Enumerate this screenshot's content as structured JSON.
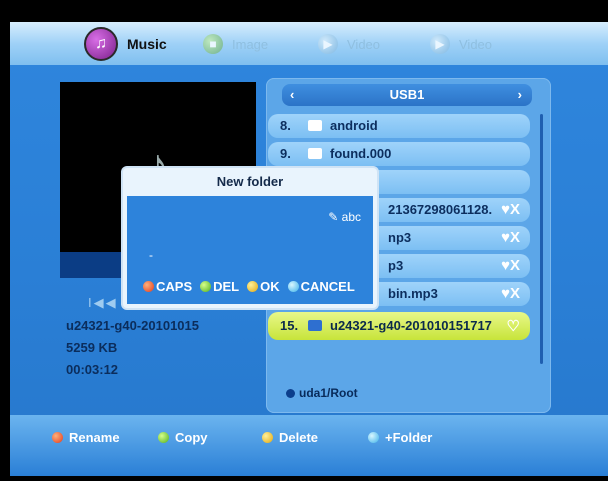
{
  "categories": [
    {
      "label": "Music",
      "icon": "music-note-icon",
      "active": true
    },
    {
      "label": "Image",
      "icon": "image-icon",
      "active": false
    },
    {
      "label": "Video",
      "icon": "video-icon",
      "active": false
    },
    {
      "label": "Video",
      "icon": "video-icon",
      "active": false
    }
  ],
  "preview": {
    "filename": "u24321-g40-20101015",
    "size": "5259 KB",
    "duration": "00:03:12",
    "controls": "I◀◀ ◀"
  },
  "filelist": {
    "directory": "USB1",
    "rows": [
      {
        "num": "8.",
        "name": "android",
        "type": "folder",
        "mark": ""
      },
      {
        "num": "9.",
        "name": "found.000",
        "type": "folder",
        "mark": ""
      },
      {
        "num": "",
        "name": "",
        "type": "folder",
        "mark": ""
      },
      {
        "num": "",
        "name": "21367298061128.",
        "type": "file",
        "mark": "♥X"
      },
      {
        "num": "",
        "name": "np3",
        "type": "file",
        "mark": "♥X"
      },
      {
        "num": "",
        "name": "p3",
        "type": "file",
        "mark": "♥X"
      },
      {
        "num": "",
        "name": "bin.mp3",
        "type": "file",
        "mark": "♥X"
      },
      {
        "num": "15.",
        "name": "u24321-g40-201010151717",
        "type": "file",
        "mark": "♡",
        "selected": true
      }
    ],
    "path": "uda1/Root"
  },
  "dialog": {
    "title": "New folder",
    "input_mode": "abc",
    "cursor": "-",
    "keys": [
      {
        "color": "red",
        "label": "CAPS"
      },
      {
        "color": "green",
        "label": "DEL"
      },
      {
        "color": "yellow",
        "label": "OK"
      },
      {
        "color": "blue",
        "label": "CANCEL"
      }
    ]
  },
  "bottom_actions": [
    {
      "color": "red",
      "label": "Rename"
    },
    {
      "color": "green",
      "label": "Copy"
    },
    {
      "color": "yellow",
      "label": "Delete"
    },
    {
      "color": "blue",
      "label": "+Folder"
    }
  ]
}
